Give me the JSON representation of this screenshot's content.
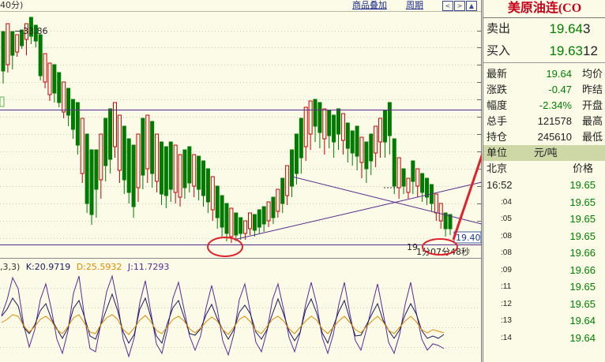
{
  "toolbar": {
    "period_label": "40分)",
    "overlay_link": "商品叠加",
    "cycle_link": "周期",
    "nav_left": "<",
    "nav_right": ">",
    "nav_up": "▲"
  },
  "main_chart": {
    "high_label": "33.86",
    "current_price_label": "19.40",
    "low_label_prefix": "19",
    "countdown_label": "1分07分48秒"
  },
  "kdj": {
    "header_prefix": ",3,3)",
    "k_label": "K:20.9719",
    "d_label": "D:25.5932",
    "j_label": "J:11.7293"
  },
  "quote": {
    "title": "美原油连(CO",
    "ask_label": "卖出",
    "ask_price": "19.64",
    "ask_qty": "3",
    "bid_label": "买入",
    "bid_price": "19.63",
    "bid_qty": "12",
    "rows": [
      {
        "label": "最新",
        "value": "19.64",
        "label2": "均价",
        "color": "#008000"
      },
      {
        "label": "涨跌",
        "value": "-0.47",
        "label2": "昨结",
        "color": "#008000"
      },
      {
        "label": "幅度",
        "value": "-2.34%",
        "label2": "开盘",
        "color": "#008000"
      },
      {
        "label": "总手",
        "value": "121578",
        "label2": "最高",
        "color": "#222222"
      },
      {
        "label": "持仓",
        "value": "245610",
        "label2": "最低",
        "color": "#222222"
      }
    ],
    "unit_label": "单位",
    "unit_value": "元/吨",
    "ticks_header_left": "北京",
    "ticks_header_right": "价格",
    "ticks": [
      {
        "time": "16:52",
        "price": "19.65"
      },
      {
        "time": ":04",
        "price": "19.65"
      },
      {
        "time": ":05",
        "price": "19.65"
      },
      {
        "time": ":08",
        "price": "19.65"
      },
      {
        "time": ":08",
        "price": "19.66"
      },
      {
        "time": ":09",
        "price": "19.66"
      },
      {
        "time": ":11",
        "price": "19.65"
      },
      {
        "time": ":12",
        "price": "19.65"
      },
      {
        "time": ":13",
        "price": "19.64"
      },
      {
        "time": ":14",
        "price": "19.64"
      }
    ]
  },
  "colors": {
    "up_candle": "#c80000",
    "down_candle": "#007a00",
    "trendline": "#5a2a8c",
    "k_line": "#1a1a60",
    "d_line": "#e08a00",
    "j_line": "#5a2a9c",
    "annotation": "#e0202a"
  }
}
